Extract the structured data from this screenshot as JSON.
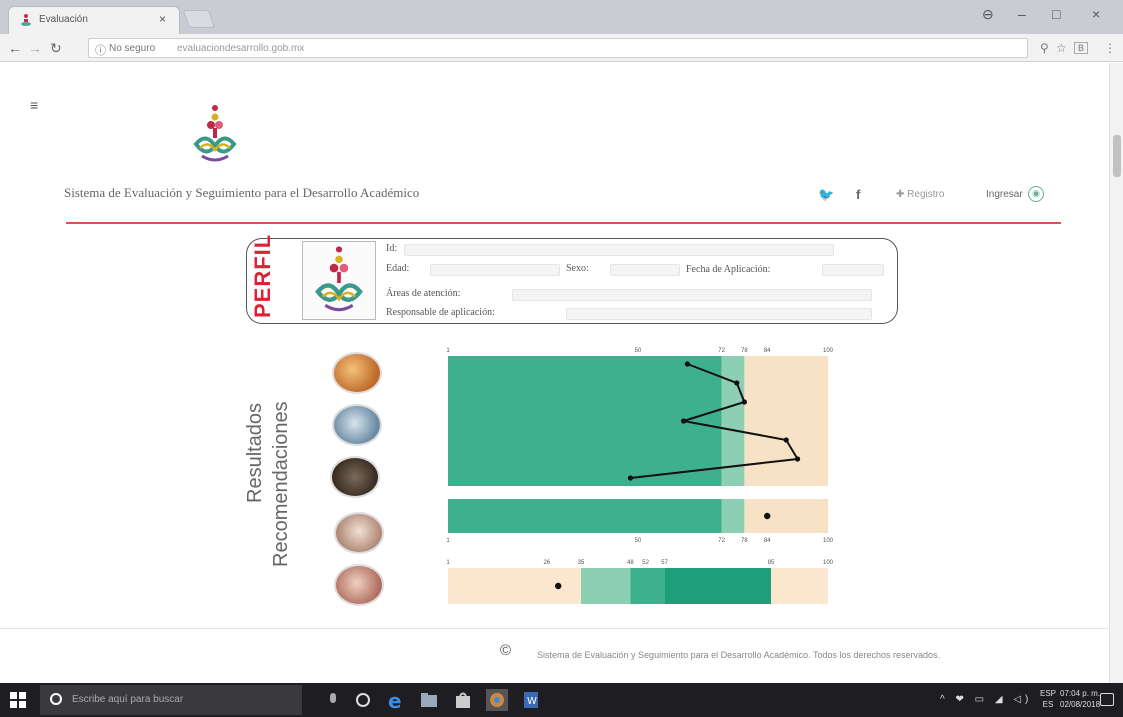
{
  "browser": {
    "tab_title": "Evaluación",
    "tab_close": "×",
    "security_label": "No seguro",
    "url": "evaluaciondesarrollo.gob.mx",
    "window_buttons": {
      "profile": "⊖",
      "minimize": "–",
      "maximize": "□",
      "close": "×"
    }
  },
  "header": {
    "menu_icon": "≡",
    "site_title": "Sistema de Evaluación y Seguimiento para el Desarrollo Académico",
    "twitter_icon": "🐦",
    "facebook_icon": "f",
    "register_label": "✚ Registro",
    "login_label": "Ingresar"
  },
  "profile": {
    "title": "PERFIL",
    "fields": {
      "id": "Id:",
      "edad": "Edad:",
      "sexo": "Sexo:",
      "fecha": "Fecha de Aplicación:",
      "areas": "Áreas de atención:",
      "responsable": "Responsable de aplicación:"
    }
  },
  "results": {
    "title": "Resultados",
    "subtitle": "Recomendaciones"
  },
  "chart_data": [
    {
      "type": "line",
      "xlim": [
        0,
        100
      ],
      "ticks": [
        0,
        50,
        72,
        78,
        84,
        100
      ],
      "tick_labels": [
        "1",
        "50",
        "72",
        "78",
        "84",
        "100"
      ],
      "bands": [
        {
          "from": 0,
          "to": 72,
          "color": "#3fb08d"
        },
        {
          "from": 72,
          "to": 78,
          "color": "#8ccfb4"
        },
        {
          "from": 78,
          "to": 100,
          "color": "#f7e2c6"
        }
      ],
      "points": [
        63,
        76,
        78,
        62,
        89,
        92,
        48
      ]
    },
    {
      "type": "dot",
      "xlim": [
        0,
        100
      ],
      "ticks": [
        0,
        50,
        72,
        78,
        84,
        100
      ],
      "tick_labels": [
        "1",
        "50",
        "72",
        "78",
        "84",
        "100"
      ],
      "bands": [
        {
          "from": 0,
          "to": 72,
          "color": "#3fb08d"
        },
        {
          "from": 72,
          "to": 78,
          "color": "#8ccfb4"
        },
        {
          "from": 78,
          "to": 100,
          "color": "#f7e2c6"
        }
      ],
      "value": 84
    },
    {
      "type": "dot",
      "xlim": [
        0,
        100
      ],
      "ticks": [
        0,
        26,
        35,
        48,
        52,
        57,
        85,
        100
      ],
      "tick_labels": [
        "1",
        "26",
        "35",
        "48",
        "52",
        "57",
        "85",
        "100"
      ],
      "bands": [
        {
          "from": 0,
          "to": 35,
          "color": "#fbe7cf"
        },
        {
          "from": 35,
          "to": 48,
          "color": "#8ccfb4"
        },
        {
          "from": 48,
          "to": 57,
          "color": "#3fb08d"
        },
        {
          "from": 57,
          "to": 85,
          "color": "#1f9e7a"
        },
        {
          "from": 85,
          "to": 100,
          "color": "#fbe7cf"
        }
      ],
      "value": 29
    }
  ],
  "footer": {
    "copyright_symbol": "©",
    "text": "Sistema de Evaluación y Seguimiento para el Desarrollo Académico. Todos los derechos reservados."
  },
  "taskbar": {
    "search_placeholder": "Escribe aquí para buscar",
    "tray_icons": "^ ❤ ▭ ◢ ◁)",
    "lang_line1": "ESP",
    "lang_line2": "ES",
    "time": "07:04 p. m.",
    "date": "02/08/2018"
  },
  "colors": {
    "accent_red": "#e05050",
    "band_green": "#3fb08d",
    "band_light_green": "#8ccfb4",
    "band_peach": "#f7e2c6"
  }
}
